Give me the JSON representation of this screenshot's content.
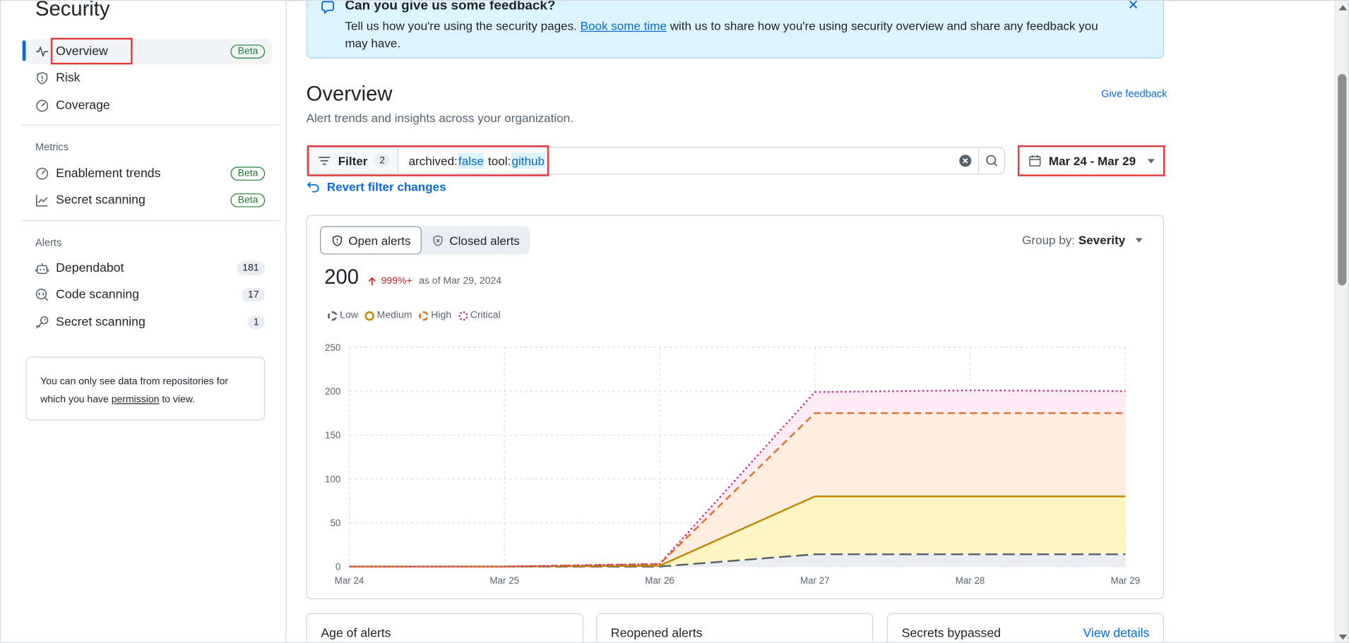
{
  "sidebar": {
    "title": "Security",
    "items_top": [
      {
        "label": "Overview",
        "badge": "Beta",
        "icon": "pulse-icon"
      },
      {
        "label": "Risk",
        "badge": "",
        "icon": "shield-alert-icon"
      },
      {
        "label": "Coverage",
        "badge": "",
        "icon": "meter-icon"
      }
    ],
    "metrics_heading": "Metrics",
    "metrics": [
      {
        "label": "Enablement trends",
        "badge": "Beta",
        "icon": "meter-icon"
      },
      {
        "label": "Secret scanning",
        "badge": "Beta",
        "icon": "graph-icon"
      }
    ],
    "alerts_heading": "Alerts",
    "alerts": [
      {
        "label": "Dependabot",
        "count": "181",
        "icon": "dependabot-icon"
      },
      {
        "label": "Code scanning",
        "count": "17",
        "icon": "codescan-icon"
      },
      {
        "label": "Secret scanning",
        "count": "1",
        "icon": "key-icon"
      }
    ],
    "note_prefix": "You can only see data from repositories for which you have ",
    "note_link": "permission",
    "note_suffix": " to view."
  },
  "banner": {
    "title": "Can you give us some feedback?",
    "text_prefix": "Tell us how you're using the security pages. ",
    "link": "Book some time",
    "text_suffix": " with us to share how you're using security overview and share any feedback you may have."
  },
  "overview": {
    "title": "Overview",
    "subtitle": "Alert trends and insights across your organization.",
    "give_feedback": "Give feedback"
  },
  "filter": {
    "label": "Filter",
    "count": "2",
    "q1_key": "archived:",
    "q1_val": "false",
    "q2_key": "tool:",
    "q2_val": "github",
    "revert": "Revert filter changes",
    "date_range": "Mar 24 - Mar 29"
  },
  "alerts_card": {
    "tab_open": "Open alerts",
    "tab_closed": "Closed alerts",
    "group_by_label": "Group by:",
    "group_by_value": "Severity",
    "total": "200",
    "trend": "999%+",
    "as_of": "as of Mar 29, 2024"
  },
  "chart_data": {
    "type": "area",
    "categories": [
      "Mar 24",
      "Mar 25",
      "Mar 26",
      "Mar 27",
      "Mar 28",
      "Mar 29"
    ],
    "ylim": [
      0,
      250
    ],
    "yticks": [
      0,
      50,
      100,
      150,
      200,
      250
    ],
    "grid": true,
    "stacked": true,
    "legend_position": "top-left",
    "series": [
      {
        "name": "Low",
        "values": [
          0,
          0,
          0,
          14,
          14,
          14
        ],
        "color": "#57606a"
      },
      {
        "name": "Medium",
        "values": [
          0,
          0,
          1,
          66,
          66,
          66
        ],
        "color": "#bf8700"
      },
      {
        "name": "High",
        "values": [
          0,
          0,
          2,
          95,
          95,
          95
        ],
        "color": "#e16f24"
      },
      {
        "name": "Critical",
        "values": [
          0,
          0,
          0,
          24,
          26,
          25
        ],
        "color": "#bf3989"
      }
    ]
  },
  "bottom_cards": [
    {
      "title": "Age of alerts",
      "link": ""
    },
    {
      "title": "Reopened alerts",
      "link": ""
    },
    {
      "title": "Secrets bypassed",
      "link": "View details"
    }
  ]
}
